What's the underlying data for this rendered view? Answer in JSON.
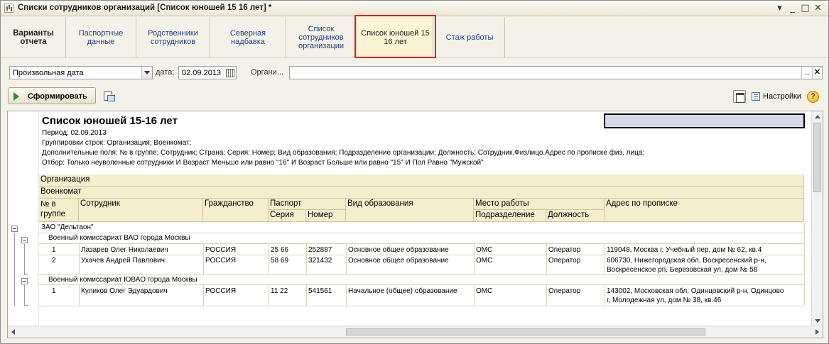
{
  "window": {
    "title": "Списки сотрудников организаций [Список юношей 15 16 лет] *",
    "buttons": {
      "menu": "▾",
      "minimize": "_",
      "maximize": "□",
      "close": "✕"
    }
  },
  "tabs": [
    {
      "label": "Варианты отчета"
    },
    {
      "label": "Паспортные данные"
    },
    {
      "label": "Родственники сотрудников"
    },
    {
      "label": "Северная надбавка"
    },
    {
      "label": "Список сотрудников организации"
    },
    {
      "label": "Список юношей 15 16 лет"
    },
    {
      "label": "Стаж работы"
    }
  ],
  "filters": {
    "date_mode": "Произвольная дата",
    "date_label": "дата:",
    "date_value": "02.09.2013",
    "org_label": "Органи...",
    "org_value": "",
    "org_select": "...",
    "org_clear": "✕"
  },
  "toolbar": {
    "generate_label": "Сформировать",
    "settings_label": "Настройки",
    "help_label": "?"
  },
  "report": {
    "title": "Список юношей 15-16 лет",
    "period": "Период: 02.09.2013",
    "grouping": "Группировки строк: Организация; Военкомат;",
    "extra_fields": "Дополнительные поля: № в группе; Сотрудник; Страна; Серия; Номер; Вид образования; Подразделение организации; Должность; Сотрудник.Физлицо.Адрес по прописке физ. лица;",
    "filter": "Отбор: Только неуволенные сотрудники И Возраст Меньше или равно \"16\" И Возраст Больше или равно \"15\" И Пол Равно \"Мужской\"",
    "headers": {
      "org": "Организация",
      "mil": "Военкомат",
      "num": "№ в группе",
      "employee": "Сотрудник",
      "citizenship": "Гражданство",
      "passport": "Паспорт",
      "series": "Серия",
      "number": "Номер",
      "education": "Вид образования",
      "workplace": "Место работы",
      "department": "Подразделение",
      "position": "Должность",
      "address": "Адрес по прописке"
    },
    "org_group": "ЗАО \"Дельтаон\"",
    "groups": [
      {
        "name": "Военный комиссариат ВАО города Москвы",
        "rows": [
          {
            "num": "1",
            "name": "Лазарев Олег Николаевич",
            "country": "РОССИЯ",
            "series": "25 66",
            "number": "252887",
            "education": "Основное общее образование",
            "dept": "ОМС",
            "position": "Оператор",
            "address1": "119048, Москва г, Учебный пер, дом № 62, кв.4",
            "address2": ""
          },
          {
            "num": "2",
            "name": "Ухачев Андрей Павлович",
            "country": "РОССИЯ",
            "series": "58 69",
            "number": "321432",
            "education": "Основное общее образование",
            "dept": "ОМС",
            "position": "Оператор",
            "address1": "606730, Нижегородская обл, Воскресенский р-н,",
            "address2": "Воскресенское рп, Березовская ул, дом № 58"
          }
        ]
      },
      {
        "name": "Военный комиссариат ЮВАО города Москвы",
        "rows": [
          {
            "num": "1",
            "name": "Куликов Олег Эдуардович",
            "country": "РОССИЯ",
            "series": "11 22",
            "number": "541561",
            "education": "Начальное (общее) образование",
            "dept": "ОМС",
            "position": "Оператор",
            "address1": "143002, Московская обл, Одинцовский р-н, Одинцово",
            "address2": "г, Молодежная ул, дом № 38, кв.46"
          }
        ]
      }
    ]
  }
}
